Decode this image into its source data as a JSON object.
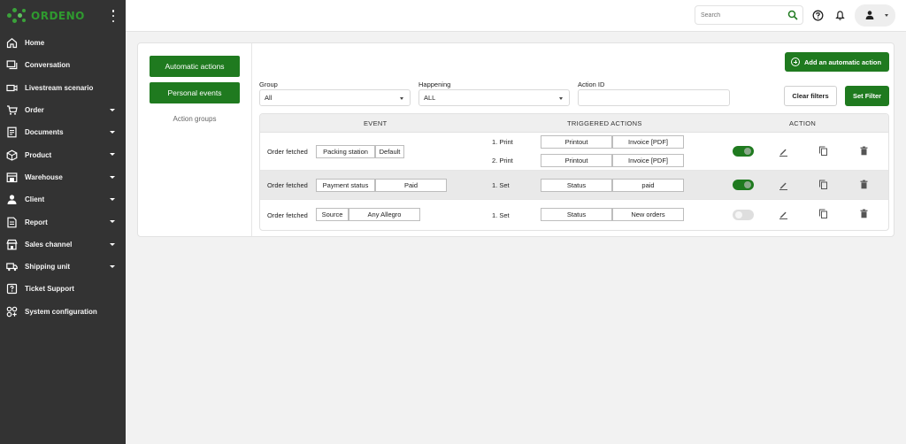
{
  "app": {
    "logo_text": "ORDENO"
  },
  "sidebar": {
    "items": [
      {
        "label": "Home",
        "icon": "home-icon",
        "caret": false
      },
      {
        "label": "Conversation",
        "icon": "chat-icon",
        "caret": false
      },
      {
        "label": "Livestream scenario",
        "icon": "video-icon",
        "caret": false
      },
      {
        "label": "Order",
        "icon": "cart-icon",
        "caret": true
      },
      {
        "label": "Documents",
        "icon": "document-icon",
        "caret": true
      },
      {
        "label": "Product",
        "icon": "box-icon",
        "caret": true
      },
      {
        "label": "Warehouse",
        "icon": "warehouse-icon",
        "caret": true
      },
      {
        "label": "Client",
        "icon": "user-icon",
        "caret": true
      },
      {
        "label": "Report",
        "icon": "report-icon",
        "caret": true
      },
      {
        "label": "Sales channel",
        "icon": "store-icon",
        "caret": true
      },
      {
        "label": "Shipping unit",
        "icon": "truck-icon",
        "caret": true
      },
      {
        "label": "Ticket Support",
        "icon": "ticket-icon",
        "caret": false
      },
      {
        "label": "System configuration",
        "icon": "config-icon",
        "caret": false
      }
    ]
  },
  "topbar": {
    "search_placeholder": "Search"
  },
  "panel": {
    "automatic_actions": "Automatic actions",
    "personal_events": "Personal events",
    "action_groups": "Action groups"
  },
  "toolbar": {
    "add_label": "Add an automatic action",
    "clear_label": "Clear filters",
    "set_label": "Set Filter"
  },
  "filters": {
    "group_label": "Group",
    "group_value": "All",
    "happening_label": "Happening",
    "happening_value": "ALL",
    "action_id_label": "Action ID",
    "action_id_value": ""
  },
  "table": {
    "headers": {
      "event": "EVENT",
      "triggered": "TRIGGERED ACTIONS",
      "action": "ACTION"
    },
    "rows": [
      {
        "event": "Order fetched",
        "chips": [
          "Packing station",
          "Default"
        ],
        "actions": [
          {
            "step": "1. Print",
            "a": "Printout",
            "b": "Invoice [PDF]"
          },
          {
            "step": "2. Print",
            "a": "Printout",
            "b": "Invoice [PDF]"
          }
        ],
        "enabled": true
      },
      {
        "event": "Order fetched",
        "chips": [
          "Payment status",
          "Paid"
        ],
        "actions": [
          {
            "step": "1. Set",
            "a": "Status",
            "b": "paid"
          }
        ],
        "enabled": true
      },
      {
        "event": "Order fetched",
        "chips": [
          "Source",
          "Any Allegro"
        ],
        "actions": [
          {
            "step": "1. Set",
            "a": "Status",
            "b": "New orders"
          }
        ],
        "enabled": false
      }
    ]
  },
  "colors": {
    "brand": "#1f7a1f",
    "sidebar": "#333333"
  }
}
